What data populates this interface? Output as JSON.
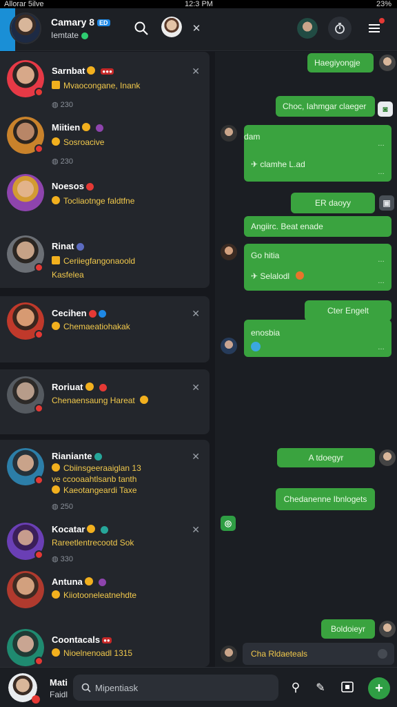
{
  "status": {
    "carrier": "Allorar 5ilve",
    "time": "12:3 PM",
    "battery": "23%"
  },
  "header": {
    "title": "Camary 8",
    "title_badge": "ED",
    "subtitle": "Iemtate"
  },
  "chats": [
    {
      "name": "Sarnbat",
      "msg": "Mvaocongane, Inank",
      "meta": "230",
      "avatar_color": "#e63946"
    },
    {
      "name": "Miitien",
      "msg": "Sosroacive",
      "meta": "230",
      "avatar_color": "#c9822b"
    },
    {
      "name": "Noesos",
      "msg": "Tocliaotnge faldtfne",
      "meta": "",
      "avatar_color": "#8e44ad"
    },
    {
      "name": "Rinat",
      "msg": "Ceriiegfangonaoold",
      "msg2": "Kasfelea",
      "meta": "",
      "avatar_color": "#6b6f75"
    },
    {
      "name": "Cecihen",
      "msg": "Chemaeatiohakak",
      "meta": "",
      "avatar_color": "#c0392b"
    },
    {
      "name": "Roriuat",
      "msg": "Chenaensaung Hareat",
      "meta": "",
      "avatar_color": "#555a60"
    },
    {
      "name": "Rianiante",
      "msg": "Cbiinsgeeraaiglan 13",
      "msg2": "ve ccooaahtlsanb tanth",
      "msg3": "Kaeotangeardi Taxe",
      "meta": "250",
      "avatar_color": "#2c7ea8"
    },
    {
      "name": "Kocatar",
      "msg": "Rareetlentrecootd Sok",
      "meta": "330",
      "avatar_color": "#6a3fb5"
    },
    {
      "name": "Antuna",
      "msg": "Kiiotooneleatnehdte",
      "meta": "",
      "avatar_color": "#b03a2e"
    },
    {
      "name": "Coontacals",
      "msg": "Nioelnenoadl 1315",
      "meta": "",
      "avatar_color": "#1f8a70"
    }
  ],
  "messages": [
    {
      "text": "Haegiyongje",
      "side": "out"
    },
    {
      "text": "Choc, Iahmgar claeger",
      "side": "out"
    },
    {
      "text": "hd tdam",
      "text2": "clamhe L.ad",
      "side": "in"
    },
    {
      "text": "ER daoyy",
      "side": "out"
    },
    {
      "text": "Angiirc. Beat enade",
      "side": "out"
    },
    {
      "text": "Go hitia",
      "text2": "Selalodl",
      "side": "in"
    },
    {
      "text": "Cter Engelt",
      "side": "out"
    },
    {
      "text": "enosbia",
      "side": "in"
    },
    {
      "text": "A tdoegyr",
      "side": "out"
    },
    {
      "text": "Chedanenne Ibnlogets",
      "side": "out"
    },
    {
      "text": "Boldoieyr",
      "side": "out"
    },
    {
      "text": "Cha Rldaeteals",
      "side": "in"
    }
  ],
  "bottom": {
    "name": "Mati",
    "sub": "Faidl",
    "search_placeholder": "Mipentiask"
  },
  "colors": {
    "bubble": "#3aa33f",
    "accent": "#1a8fd6",
    "yellow_text": "#f2c94c",
    "send": "#2f9e44"
  }
}
